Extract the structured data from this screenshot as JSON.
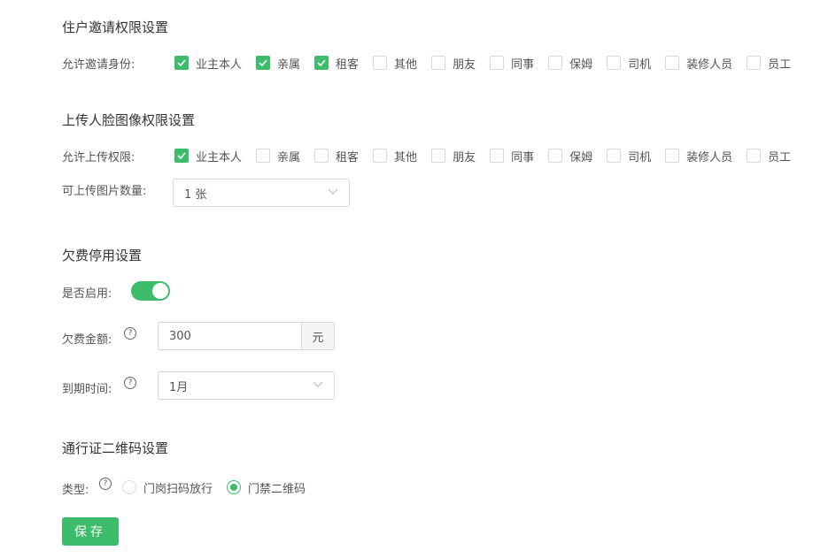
{
  "invite": {
    "title": "住户邀请权限设置",
    "label": "允许邀请身份:",
    "options": [
      {
        "label": "业主本人",
        "checked": true
      },
      {
        "label": "亲属",
        "checked": true
      },
      {
        "label": "租客",
        "checked": true
      },
      {
        "label": "其他",
        "checked": false
      },
      {
        "label": "朋友",
        "checked": false
      },
      {
        "label": "同事",
        "checked": false
      },
      {
        "label": "保姆",
        "checked": false
      },
      {
        "label": "司机",
        "checked": false
      },
      {
        "label": "装修人员",
        "checked": false
      },
      {
        "label": "员工",
        "checked": false
      }
    ]
  },
  "upload": {
    "title": "上传人脸图像权限设置",
    "label": "允许上传权限:",
    "options": [
      {
        "label": "业主本人",
        "checked": true
      },
      {
        "label": "亲属",
        "checked": false
      },
      {
        "label": "租客",
        "checked": false
      },
      {
        "label": "其他",
        "checked": false
      },
      {
        "label": "朋友",
        "checked": false
      },
      {
        "label": "同事",
        "checked": false
      },
      {
        "label": "保姆",
        "checked": false
      },
      {
        "label": "司机",
        "checked": false
      },
      {
        "label": "装修人员",
        "checked": false
      },
      {
        "label": "员工",
        "checked": false
      }
    ],
    "count_label": "可上传图片数量:",
    "count_value": "1 张"
  },
  "arrears": {
    "title": "欠费停用设置",
    "enable_label": "是否启用:",
    "enabled": true,
    "amount_label": "欠费金额:",
    "amount_value": "300",
    "amount_unit": "元",
    "due_label": "到期时间:",
    "due_value": "1月"
  },
  "pass": {
    "title": "通行证二维码设置",
    "type_label": "类型:",
    "options": [
      {
        "label": "门岗扫码放行",
        "checked": false
      },
      {
        "label": "门禁二维码",
        "checked": true
      }
    ]
  },
  "save_label": "保存",
  "accent_color": "#3dbd6b"
}
